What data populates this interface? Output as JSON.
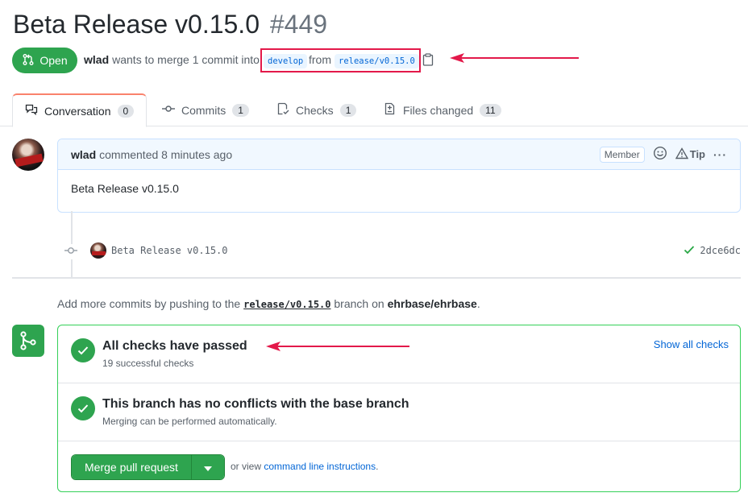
{
  "pr": {
    "title": "Beta Release v0.15.0",
    "number": "#449",
    "state": "Open",
    "author": "wlad",
    "merge_text": "wants to merge 1 commit into",
    "base_branch": "develop",
    "from_word": "from",
    "head_branch": "release/v0.15.0"
  },
  "tabs": [
    {
      "label": "Conversation",
      "count": "0"
    },
    {
      "label": "Commits",
      "count": "1"
    },
    {
      "label": "Checks",
      "count": "1"
    },
    {
      "label": "Files changed",
      "count": "11"
    }
  ],
  "comment": {
    "author": "wlad",
    "action": "commented 8 minutes ago",
    "badge": "Member",
    "tip_label": "Tip",
    "body": "Beta Release v0.15.0"
  },
  "commit": {
    "message": "Beta Release v0.15.0",
    "sha": "2dce6dc"
  },
  "hint": {
    "prefix": "Add more commits by pushing to the",
    "branch": "release/v0.15.0",
    "middle": "branch on",
    "repo": "ehrbase/ehrbase",
    "suffix": "."
  },
  "merge": {
    "checks_title": "All checks have passed",
    "checks_sub": "19 successful checks",
    "show_all": "Show all checks",
    "conflicts_title": "This branch has no conflicts with the base branch",
    "conflicts_sub": "Merging can be performed automatically.",
    "button_label": "Merge pull request",
    "or_view": "or view",
    "cli_link": "command line instructions",
    "cli_suffix": "."
  },
  "colors": {
    "green": "#2ea44f",
    "annotation_red": "#e3194a",
    "link_blue": "#0366d6"
  }
}
